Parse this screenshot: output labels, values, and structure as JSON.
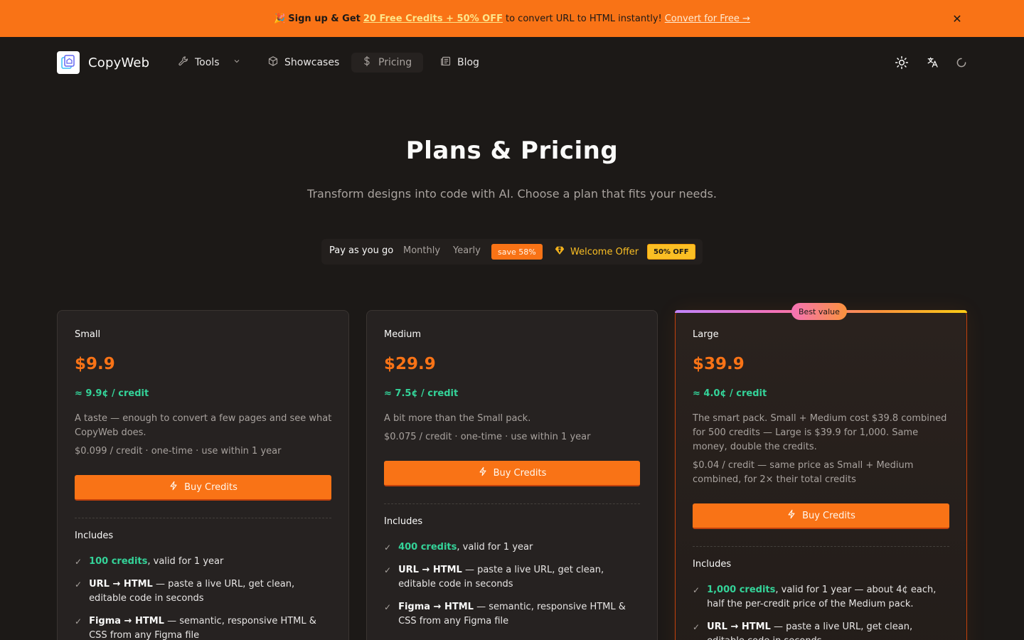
{
  "banner": {
    "emoji": "🎉",
    "strong": "Sign up & Get",
    "promo": "20 Free Credits + 50% OFF",
    "rest": "to convert URL to HTML instantly!",
    "cta": "Convert for Free →",
    "close": "✕"
  },
  "brand": {
    "name": "CopyWeb"
  },
  "nav": {
    "tools": "Tools",
    "showcases": "Showcases",
    "pricing": "Pricing",
    "blog": "Blog"
  },
  "hero": {
    "title": "Plans & Pricing",
    "subtitle": "Transform designs into code with AI. Choose a plan that fits your needs."
  },
  "billing": {
    "options": [
      "Pay as you go",
      "Monthly",
      "Yearly"
    ],
    "selected": "Pay as you go",
    "yearly_badge": "save 58%",
    "welcome": "Welcome Offer",
    "welcome_badge": "50% OFF"
  },
  "plans": [
    {
      "name": "Small",
      "price": "$9.9",
      "per_credit": "≈ 9.9¢ / credit",
      "description": "A taste — enough to convert a few pages and see what CopyWeb does.",
      "note": "$0.099 / credit · one-time · use within 1 year",
      "button": "Buy Credits",
      "includes": "Includes",
      "features": [
        {
          "highlight": "100 credits",
          "text": ", valid for 1 year"
        },
        {
          "highlight": "URL → HTML",
          "text": " — paste a live URL, get clean, editable code in seconds"
        },
        {
          "highlight": "Figma → HTML",
          "text": " — semantic, responsive HTML & CSS from any Figma file"
        }
      ]
    },
    {
      "name": "Medium",
      "price": "$29.9",
      "per_credit": "≈ 7.5¢ / credit",
      "description": "A bit more than the Small pack.",
      "note": "$0.075 / credit · one-time · use within 1 year",
      "button": "Buy Credits",
      "includes": "Includes",
      "features": [
        {
          "highlight": "400 credits",
          "text": ", valid for 1 year"
        },
        {
          "highlight": "URL → HTML",
          "text": " — paste a live URL, get clean, editable code in seconds"
        },
        {
          "highlight": "Figma → HTML",
          "text": " — semantic, responsive HTML & CSS from any Figma file"
        }
      ]
    },
    {
      "name": "Large",
      "badge": "Best value",
      "price": "$39.9",
      "per_credit": "≈ 4.0¢ / credit",
      "description": "The smart pack. Small + Medium cost $39.8 combined for 500 credits — Large is $39.9 for 1,000. Same money, double the credits.",
      "note": "$0.04 / credit — same price as Small + Medium combined, for 2× their total credits",
      "button": "Buy Credits",
      "includes": "Includes",
      "features": [
        {
          "highlight": "1,000 credits",
          "text": ", valid for 1 year — about 4¢ each, half the per-credit price of the Medium pack."
        },
        {
          "highlight": "URL → HTML",
          "text": " — paste a live URL, get clean, editable code in seconds"
        }
      ]
    }
  ],
  "colors": {
    "accent": "#f97316",
    "background": "#1c1917",
    "credit_green": "#34d399",
    "gold": "#fbbf24"
  },
  "icons": {
    "tools": "wrench-icon",
    "showcases": "cube-icon",
    "pricing": "dollar-icon",
    "blog": "newspaper-icon",
    "theme": "sun-icon",
    "language": "translate-icon",
    "loading": "spinner-icon",
    "buy": "lightning-icon",
    "feature": "check-icon"
  }
}
